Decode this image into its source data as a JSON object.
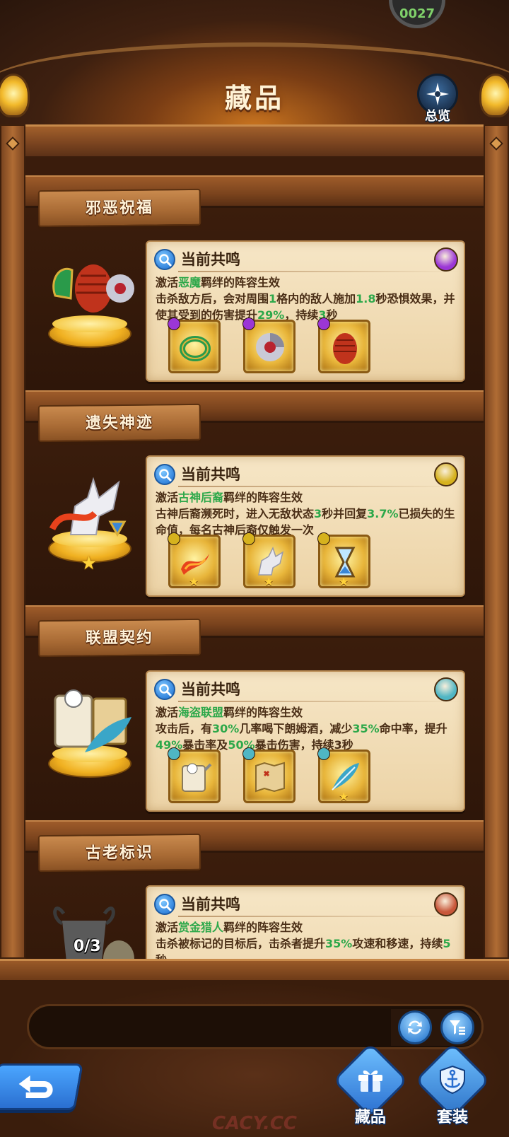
{
  "header": {
    "title": "藏品",
    "overview_label": "总览",
    "top_badge_text": "0027"
  },
  "colors": {
    "highlight_green": "#2da84a",
    "card_bg": "#f6e6c6",
    "wood": "#9e5c2a",
    "button_blue": "#2a6fd0"
  },
  "sections": [
    {
      "name": "邪恶祝福",
      "card_title": "当前共鸣",
      "faction_icon": "demon-face-icon",
      "faction_color": "#9b36d6",
      "line1_pre": "激活",
      "line1_hl": "恶魔",
      "line1_post": "羁绊的阵容生效",
      "effect_parts": [
        "击杀敌方后，会对周围",
        "1",
        "格内的敌人施加",
        "1.8",
        "秒恐惧效果，并使其受到的伤害提升",
        "29%",
        "，持续",
        "3",
        "秒"
      ],
      "items": [
        {
          "name": "green-ring-icon",
          "dot": "#9b36d6",
          "star": ""
        },
        {
          "name": "silver-blade-wheel-icon",
          "dot": "#9b36d6",
          "star": ""
        },
        {
          "name": "red-egg-icon",
          "dot": "#9b36d6",
          "star": ""
        }
      ],
      "trophy": {
        "icon": "demon-egg-trophy-icon",
        "star": "",
        "count": ""
      }
    },
    {
      "name": "遗失神迹",
      "card_title": "当前共鸣",
      "faction_icon": "eye-of-god-icon",
      "faction_color": "#d6b21e",
      "line1_pre": "激活",
      "line1_hl": "古神后裔",
      "line1_post": "羁绊的阵容生效",
      "effect_parts": [
        "古神后裔濒死时，进入无敌状态",
        "3",
        "秒并回复",
        "3.7%",
        "已损失的生命值，每名古神后裔仅触发一次",
        "",
        "",
        "",
        ""
      ],
      "items": [
        {
          "name": "fire-ribbon-icon",
          "dot": "#d6b21e",
          "star": "★"
        },
        {
          "name": "pegasus-statue-icon",
          "dot": "#d6b21e",
          "star": "★"
        },
        {
          "name": "hourglass-icon",
          "dot": "#d6b21e",
          "star": "★"
        }
      ],
      "trophy": {
        "icon": "pegasus-trophy-icon",
        "star": "★",
        "count": ""
      }
    },
    {
      "name": "联盟契约",
      "card_title": "当前共鸣",
      "faction_icon": "pirate-skull-icon",
      "faction_color": "#4fb6c4",
      "line1_pre": "激活",
      "line1_hl": "海盗联盟",
      "line1_post": "羁绊的阵容生效",
      "effect_parts": [
        "攻击后，有",
        "30%",
        "几率喝下朗姆酒，减少",
        "35%",
        "命中率，提升",
        "49%",
        "暴击率及",
        "50%",
        "暴击伤害，持续3秒"
      ],
      "items": [
        {
          "name": "skull-scroll-icon",
          "dot": "#4fb6c4",
          "star": ""
        },
        {
          "name": "treasure-map-icon",
          "dot": "#4fb6c4",
          "star": ""
        },
        {
          "name": "feather-quill-icon",
          "dot": "#4fb6c4",
          "star": "★"
        }
      ],
      "trophy": {
        "icon": "pirate-scroll-trophy-icon",
        "star": "",
        "count": ""
      }
    },
    {
      "name": "古老标识",
      "card_title": "当前共鸣",
      "faction_icon": "crosshair-target-icon",
      "faction_color": "#c8573a",
      "line1_pre": "激活",
      "line1_hl": "赏金猎人",
      "line1_post": "羁绊的阵容生效",
      "effect_parts": [
        "击杀被标记的目标后，击杀者提升",
        "35%",
        "攻速和移速，持续",
        "5",
        "秒",
        "",
        "",
        "",
        ""
      ],
      "items": [
        {
          "name": "locked-item-icon",
          "dot": "#c8573a",
          "star": ""
        },
        {
          "name": "locked-item-icon",
          "dot": "#c8573a",
          "star": ""
        },
        {
          "name": "locked-item-icon",
          "dot": "#c8573a",
          "star": ""
        }
      ],
      "trophy": {
        "icon": "horned-skull-trophy-icon",
        "star": "",
        "count": "0/3"
      }
    }
  ],
  "bottom": {
    "search_value": "",
    "nav": [
      {
        "label": "藏品",
        "icon": "gift-box-icon"
      },
      {
        "label": "套装",
        "icon": "anchor-shield-icon"
      }
    ],
    "watermark": "CACY.CC"
  }
}
